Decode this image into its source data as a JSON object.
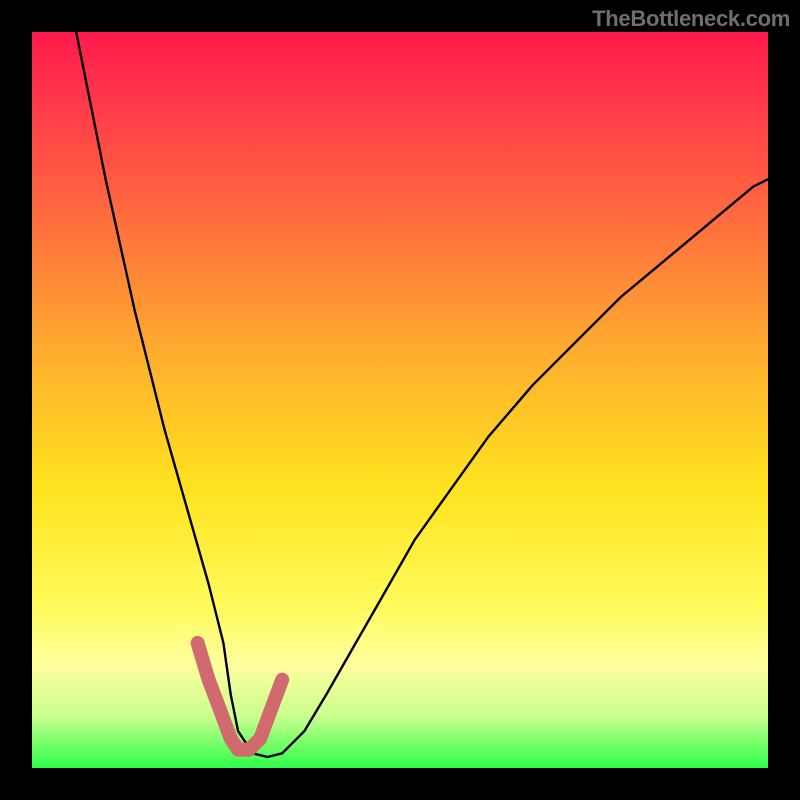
{
  "attribution": "TheBottleneck.com",
  "gradient": {
    "css": "linear-gradient(to bottom, #ff1a4d 0%, #ff3a4a 10%, #ff6b3e 25%, #ffb22e 45%, #ffe31e 62%, #fffb5c 78%, #fffe9e 86%, #c9ff8e 93%, #2dff4a 100%)"
  },
  "chart_data": {
    "type": "line",
    "title": "",
    "xlabel": "",
    "ylabel": "",
    "xlim": [
      0,
      100
    ],
    "ylim": [
      0,
      100
    ],
    "grid": false,
    "legend": false,
    "series": [
      {
        "name": "main-curve",
        "x": [
          6,
          8,
          10,
          12,
          14,
          16,
          18,
          20,
          22,
          24,
          26,
          27,
          28,
          30,
          32,
          34,
          37,
          40,
          44,
          48,
          52,
          57,
          62,
          68,
          74,
          80,
          86,
          92,
          98,
          100
        ],
        "y": [
          100,
          90,
          80,
          71,
          62,
          54,
          46,
          39,
          32,
          25,
          17,
          10,
          5,
          2,
          1.5,
          2,
          5,
          10,
          17,
          24,
          31,
          38,
          45,
          52,
          58,
          64,
          69,
          74,
          79,
          80
        ]
      },
      {
        "name": "highlight-segment",
        "x": [
          22.5,
          24,
          25.5,
          27,
          28,
          29.5,
          31,
          32.5,
          34
        ],
        "y": [
          17,
          12,
          8,
          4,
          2.5,
          2.5,
          4,
          8,
          12
        ]
      }
    ],
    "annotations": []
  }
}
